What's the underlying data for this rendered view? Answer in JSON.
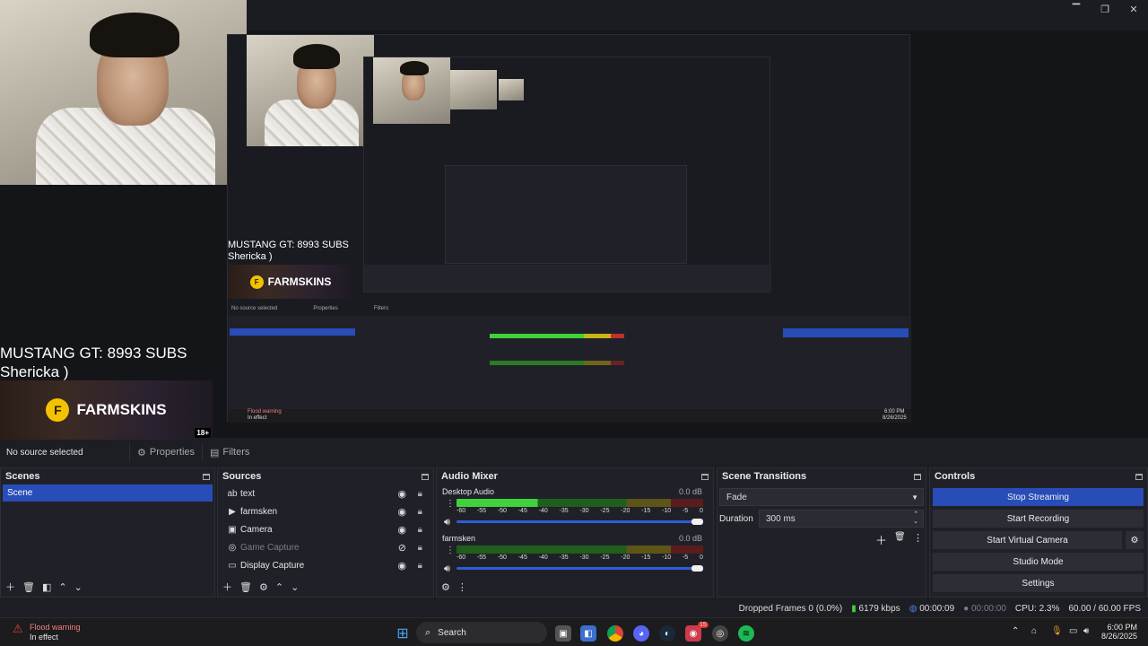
{
  "window": {
    "minimize_glyph": "▔",
    "restore_glyph": "❐",
    "close_glyph": "✕"
  },
  "preview": {
    "subs_line1": "MUSTANG GT: 8993 SUBS",
    "subs_line2": "Shericka )",
    "banner_text": "FARMSKINS",
    "banner_badge": "18+",
    "nested_subs_line1": "MUSTANG GT: 8993 SUBS",
    "nested_subs_line2": "Shericka )",
    "nested_no_source": "No source selected",
    "nested_properties": "Properties",
    "nested_filters": "Filters",
    "nested_flood": "Flood warning",
    "nested_flood_sub": "In effect",
    "nested_date": "8/26/2025",
    "nested_time": "6:00 PM"
  },
  "source_bar": {
    "no_source": "No source selected",
    "properties": "Properties",
    "filters": "Filters"
  },
  "scenes": {
    "title": "Scenes",
    "items": [
      "Scene"
    ]
  },
  "sources": {
    "title": "Sources",
    "items": [
      {
        "icon": "text-icon",
        "label": "text",
        "hidden": false
      },
      {
        "icon": "media-icon",
        "label": "farmsken",
        "hidden": false
      },
      {
        "icon": "camera-icon",
        "label": "Camera",
        "hidden": false
      },
      {
        "icon": "gamepad-icon",
        "label": "Game Capture",
        "hidden": true
      },
      {
        "icon": "monitor-icon",
        "label": "Display Capture",
        "hidden": false
      }
    ]
  },
  "audio": {
    "title": "Audio Mixer",
    "channels": [
      {
        "name": "Desktop Audio",
        "db": "0.0 dB",
        "level": 0.33
      },
      {
        "name": "farmsken",
        "db": "0.0 dB",
        "level": 0.0
      }
    ],
    "ticks": [
      "-60",
      "-55",
      "-50",
      "-45",
      "-40",
      "-35",
      "-30",
      "-25",
      "-20",
      "-15",
      "-10",
      "-5",
      "0"
    ]
  },
  "transitions": {
    "title": "Scene Transitions",
    "selected": "Fade",
    "duration_label": "Duration",
    "duration_value": "300 ms"
  },
  "controls": {
    "title": "Controls",
    "stop_streaming": "Stop Streaming",
    "start_recording": "Start Recording",
    "start_virtual_camera": "Start Virtual Camera",
    "studio_mode": "Studio Mode",
    "settings": "Settings"
  },
  "status": {
    "dropped_frames": "Dropped Frames 0 (0.0%)",
    "bitrate": "6179 kbps",
    "stream_time": "00:00:09",
    "record_time": "00:00:00",
    "cpu": "CPU: 2.3%",
    "fps": "60.00 / 60.00 FPS"
  },
  "taskbar": {
    "weather_title": "Flood warning",
    "weather_sub": "In effect",
    "search_placeholder": "Search",
    "time": "6:00 PM",
    "date": "8/26/2025",
    "badge": "15"
  },
  "colors": {
    "accent": "#284cb8",
    "meter_green": "#3fd23b",
    "meter_yellow": "#c7b619",
    "meter_red": "#c03030"
  }
}
